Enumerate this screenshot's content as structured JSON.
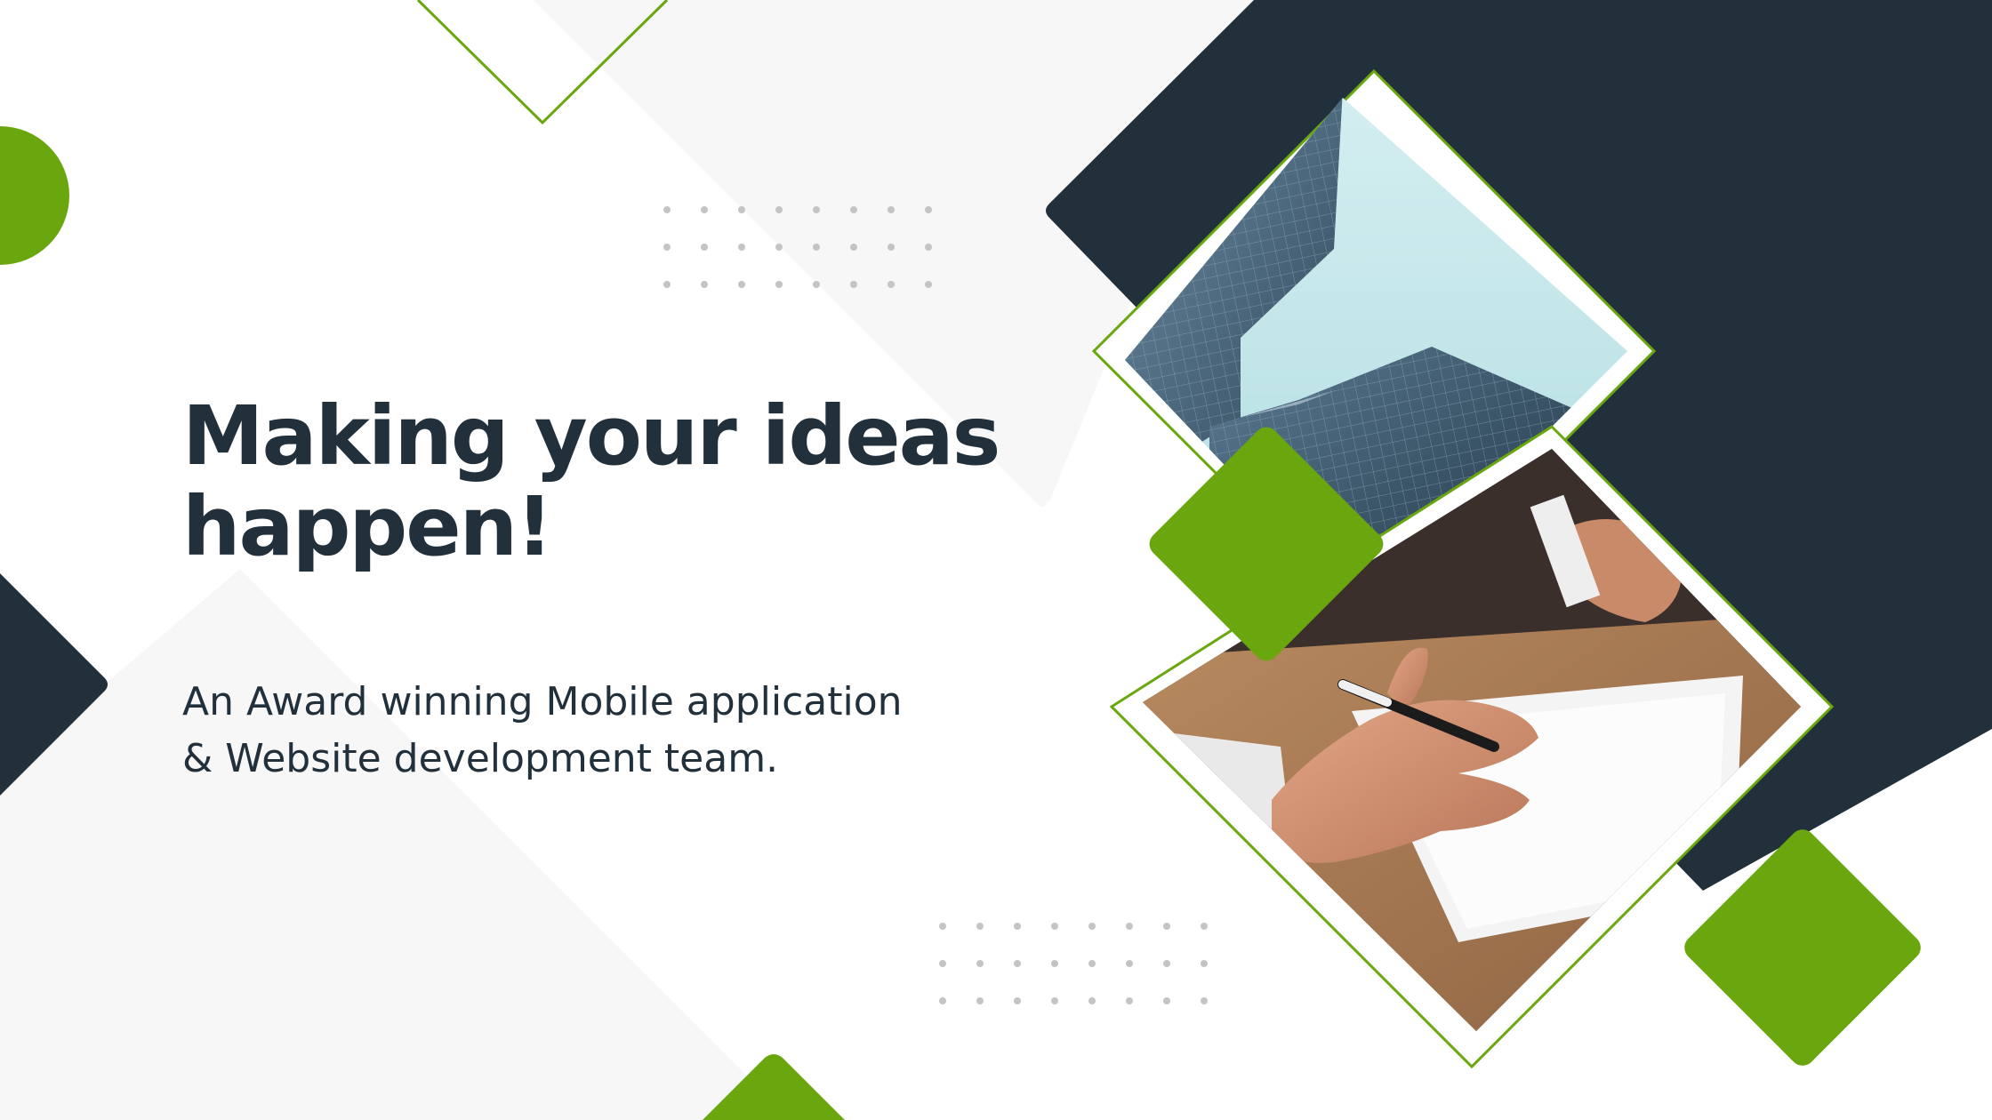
{
  "slide": {
    "headline": {
      "line1": "Making your ideas",
      "line2": "happen!"
    },
    "subheadline": {
      "line1": "An Award winning Mobile application",
      "line2": "& Website development team."
    },
    "images": [
      {
        "name": "skyscraper-photo",
        "subject": "glass skyscrapers viewed from below against a pale sky"
      },
      {
        "name": "meeting-photo",
        "subject": "hand holding a pen over documents on a wooden desk"
      }
    ]
  },
  "colors": {
    "brand_green": "#6aa70e",
    "dark_navy": "#22303c",
    "light_gray": "#f7f7f7",
    "dot_gray": "#c4c4c4",
    "text": "#22303c"
  }
}
